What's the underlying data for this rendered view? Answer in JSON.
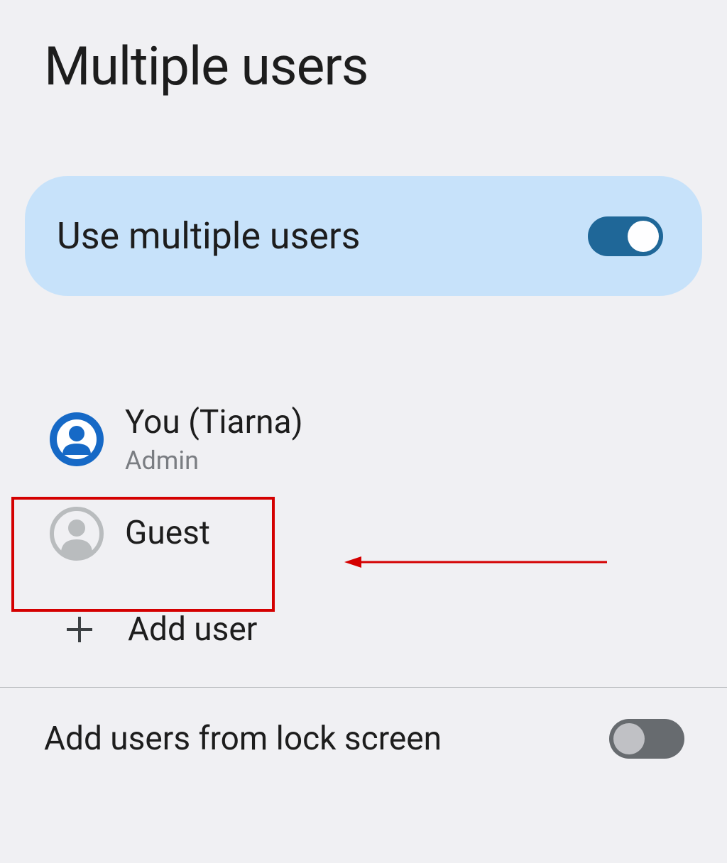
{
  "page": {
    "title": "Multiple users"
  },
  "toggle_card": {
    "label": "Use multiple users",
    "state": "on"
  },
  "users": [
    {
      "name": "You (Tiarna)",
      "subtitle": "Admin",
      "avatar_type": "primary",
      "highlighted": false
    },
    {
      "name": "Guest",
      "subtitle": "",
      "avatar_type": "secondary",
      "highlighted": true
    }
  ],
  "add_user": {
    "label": "Add user"
  },
  "lock_screen": {
    "label": "Add users from lock screen",
    "state": "off"
  },
  "annotation": {
    "type": "arrow",
    "color": "#d40000"
  }
}
